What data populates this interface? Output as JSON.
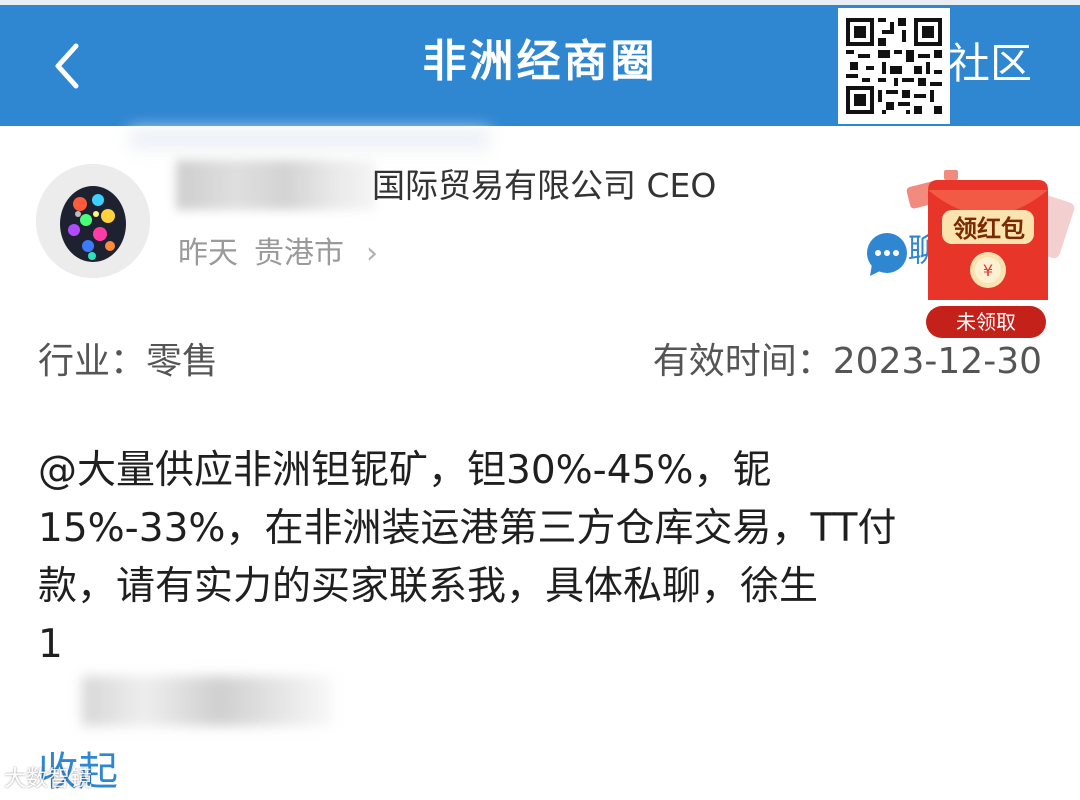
{
  "colors": {
    "header_bg": "#2f86d1",
    "link": "#2f86d1",
    "text_primary": "#1f1f1f",
    "text_secondary": "#9a9a9a",
    "envelope_red": "#e8352a"
  },
  "header": {
    "back_icon": "chevron-left-icon",
    "title": "非洲经商圈",
    "community_label": "社区",
    "qr_icon": "qr-code-icon"
  },
  "author": {
    "title": "国际贸易有限公司 CEO",
    "time": "昨天",
    "location": "贵港市",
    "chevron": "›",
    "chat_icon": "chat-bubble-icon",
    "chat_label_partial": "聊"
  },
  "red_packet": {
    "label": "领红包",
    "status": "未领取",
    "icon": "red-envelope-icon"
  },
  "info": {
    "industry": "行业：零售",
    "valid_until": "有效时间：2023-12-30"
  },
  "post": {
    "lines": [
      "@大量供应非洲钽铌矿，钽30%-45%，铌",
      "15%-33%，在非洲装运港第三方仓库交易，TT付",
      "款，请有实力的买家联系我，具体私聊，徐生"
    ],
    "phone_visible": "1"
  },
  "actions": {
    "collapse": "收起"
  },
  "watermark": "大数智镜"
}
